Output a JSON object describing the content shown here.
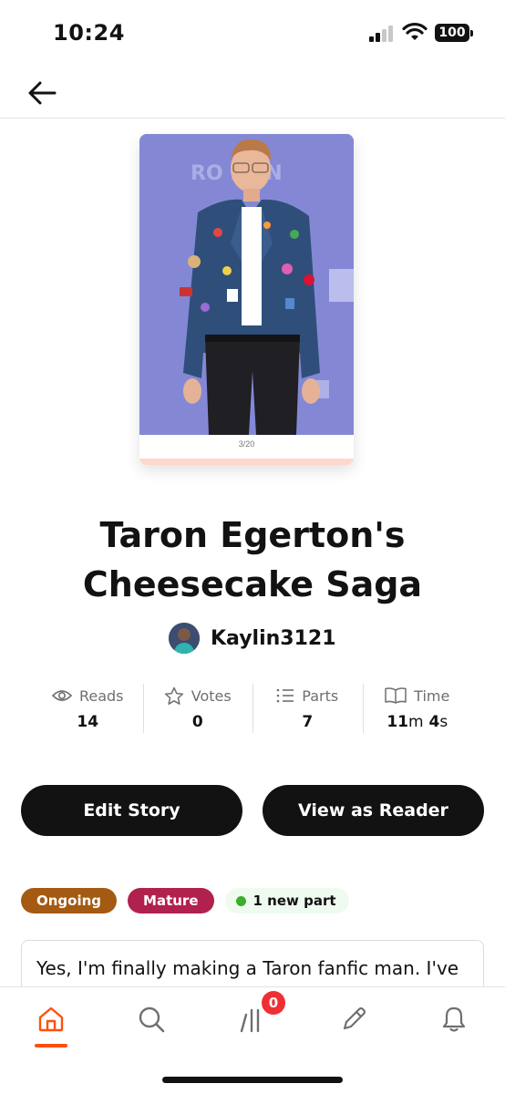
{
  "status": {
    "time": "10:24",
    "battery": "100"
  },
  "cover": {
    "caption": "3/20",
    "backdrop_text": "RO    MAN"
  },
  "story": {
    "title_line1": "Taron Egerton's",
    "title_line2": "Cheesecake Saga",
    "author": "Kaylin3121"
  },
  "stats": [
    {
      "label": "Reads",
      "icon": "eye-icon",
      "value": "14"
    },
    {
      "label": "Votes",
      "icon": "star-icon",
      "value": "0"
    },
    {
      "label": "Parts",
      "icon": "list-icon",
      "value": "7"
    },
    {
      "label": "Time",
      "icon": "book-icon",
      "value_num1": "11",
      "value_unit1": "m",
      "value_num2": " 4",
      "value_unit2": "s"
    }
  ],
  "actions": {
    "edit": "Edit Story",
    "view": "View as Reader"
  },
  "tags": {
    "ongoing": "Ongoing",
    "mature": "Mature",
    "new_part": "1 new part"
  },
  "description": "Yes, I'm finally making a Taron fanfic man. I've",
  "tabbar": {
    "library_badge": "0",
    "active": "home"
  },
  "colors": {
    "accent": "#ff500a",
    "ongoing": "#a45a12",
    "mature": "#b1214e",
    "new_dot": "#3dad2a",
    "badge": "#f02f32"
  }
}
